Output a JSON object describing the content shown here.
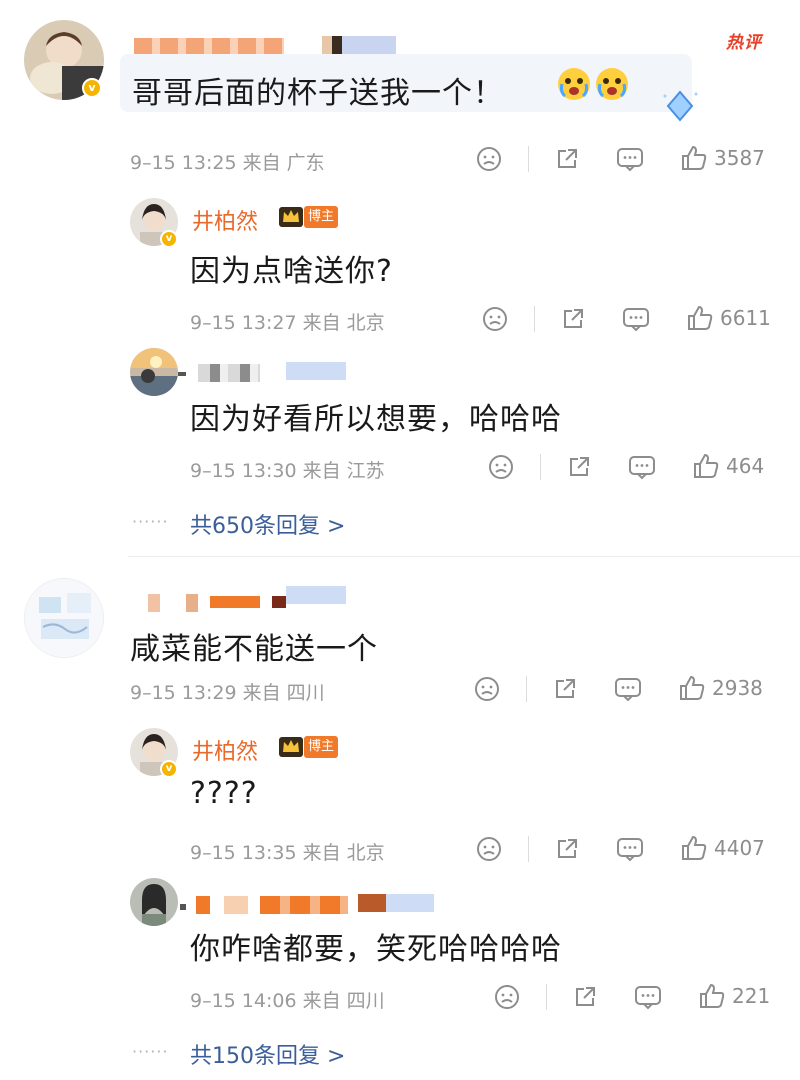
{
  "hot_label": "热评",
  "comments": [
    {
      "text": "哥哥后面的杯子送我一个！",
      "meta": "9–15 13:25  来自 广东",
      "likes": "3587",
      "replies": [
        {
          "name": "井柏然",
          "badge": "博主",
          "text": "因为点啥送你?",
          "meta": "9–15 13:27  来自 北京",
          "likes": "6611"
        },
        {
          "text": "因为好看所以想要，哈哈哈",
          "meta": "9–15 13:30  来自 江苏",
          "likes": "464"
        }
      ],
      "more": "共650条回复 >"
    },
    {
      "text": "咸菜能不能送一个",
      "meta": "9–15 13:29  来自 四川",
      "likes": "2938",
      "replies": [
        {
          "name": "井柏然",
          "badge": "博主",
          "text": "????",
          "meta": "9–15 13:35  来自 北京",
          "likes": "4407"
        },
        {
          "text": "你咋啥都要，笑死哈哈哈哈",
          "meta": "9–15 14:06  来自 四川",
          "likes": "221"
        }
      ],
      "more": "共150条回复 >"
    }
  ],
  "more_dots": "······",
  "colors": {
    "author": "#e8692a",
    "link": "#3b5e9a",
    "hot": "#e8412b",
    "meta": "#9a9a9a"
  },
  "icons": [
    "sad-face-icon",
    "share-icon",
    "comment-icon",
    "thumbs-up-icon",
    "crown-icon",
    "verified-icon"
  ]
}
